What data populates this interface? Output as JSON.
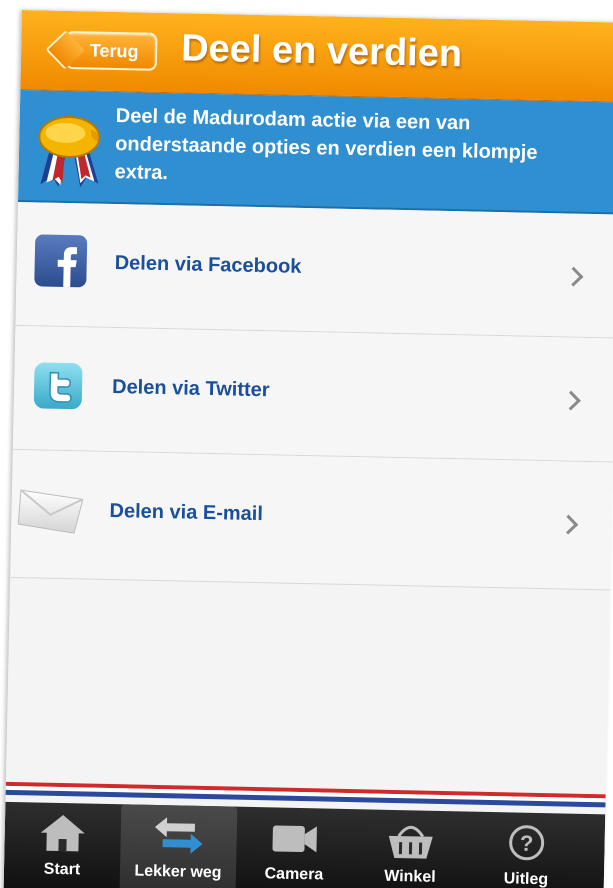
{
  "header": {
    "back_label": "Terug",
    "title": "Deel en verdien"
  },
  "banner": {
    "text": "Deel de Madurodam actie via een van\nonderstaande opties en verdien een klompje\nextra.",
    "icon": "medal-icon"
  },
  "share_options": [
    {
      "label": "Delen via Facebook",
      "icon": "facebook-icon"
    },
    {
      "label": "Delen via Twitter",
      "icon": "twitter-icon"
    },
    {
      "label": "Delen via E-mail",
      "icon": "email-icon"
    }
  ],
  "tabs": [
    {
      "label": "Start",
      "icon": "home-icon",
      "active": false
    },
    {
      "label": "Lekker weg",
      "icon": "swap-arrows-icon",
      "active": true
    },
    {
      "label": "Camera",
      "icon": "camera-icon",
      "active": false
    },
    {
      "label": "Winkel",
      "icon": "basket-icon",
      "active": false
    },
    {
      "label": "Uitleg",
      "icon": "help-icon",
      "active": false
    }
  ],
  "colors": {
    "header_orange": "#f08a00",
    "banner_blue": "#2f8fd0",
    "link_blue": "#1a4f9a",
    "flag_red": "#d02a2a",
    "flag_blue": "#2c4a9c"
  }
}
